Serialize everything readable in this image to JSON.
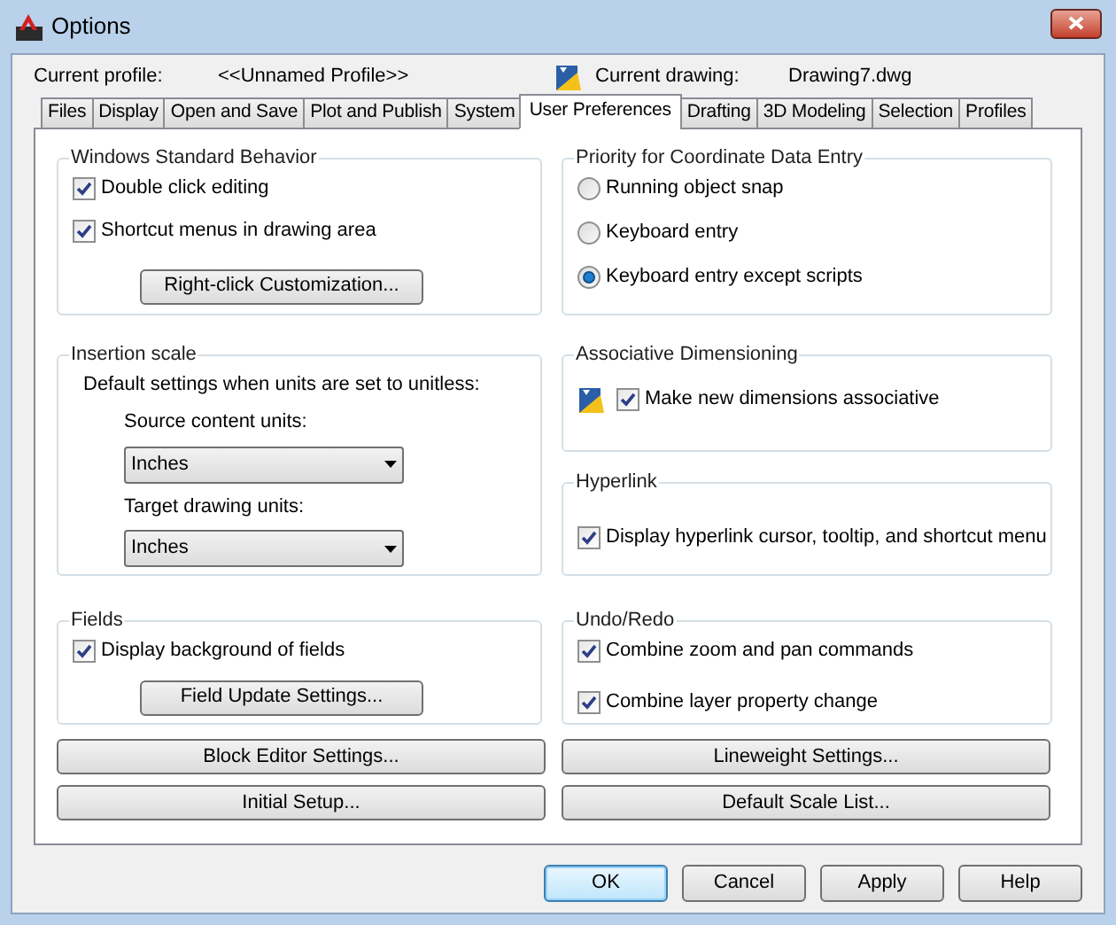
{
  "window": {
    "title": "Options"
  },
  "profile": {
    "label": "Current profile:",
    "value": "<<Unnamed Profile>>"
  },
  "drawing": {
    "label": "Current drawing:",
    "value": "Drawing7.dwg"
  },
  "tabs": [
    {
      "label": "Files",
      "selected": false
    },
    {
      "label": "Display",
      "selected": false
    },
    {
      "label": "Open and Save",
      "selected": false
    },
    {
      "label": "Plot and Publish",
      "selected": false
    },
    {
      "label": "System",
      "selected": false
    },
    {
      "label": "User Preferences",
      "selected": true
    },
    {
      "label": "Drafting",
      "selected": false
    },
    {
      "label": "3D Modeling",
      "selected": false
    },
    {
      "label": "Selection",
      "selected": false
    },
    {
      "label": "Profiles",
      "selected": false
    }
  ],
  "left_groups": [
    {
      "title": "Windows Standard Behavior",
      "items": [
        {
          "kind": "checkbox",
          "label": "Double click editing",
          "checked": true
        },
        {
          "kind": "checkbox",
          "label": "Shortcut menus in drawing area",
          "checked": true
        },
        {
          "kind": "button",
          "label": "Right-click Customization..."
        }
      ]
    },
    {
      "title": "Insertion scale",
      "items": [
        {
          "kind": "text",
          "label": "Default settings when units are set to unitless:"
        },
        {
          "kind": "label",
          "label": "Source content units:"
        },
        {
          "kind": "dropdown",
          "value": "Inches"
        },
        {
          "kind": "label",
          "label": "Target drawing units:"
        },
        {
          "kind": "dropdown",
          "value": "Inches"
        }
      ]
    },
    {
      "title": "Fields",
      "items": [
        {
          "kind": "checkbox",
          "label": "Display background of fields",
          "checked": true
        },
        {
          "kind": "button",
          "label": "Field Update Settings..."
        }
      ]
    }
  ],
  "right_groups": [
    {
      "title": "Priority for Coordinate Data Entry",
      "items": [
        {
          "kind": "radio",
          "label": "Running object snap",
          "selected": false
        },
        {
          "kind": "radio",
          "label": "Keyboard entry",
          "selected": false
        },
        {
          "kind": "radio",
          "label": "Keyboard entry except scripts",
          "selected": true
        }
      ]
    },
    {
      "title": "Associative Dimensioning",
      "items": [
        {
          "kind": "icon_checkbox",
          "label": "Make new dimensions associative",
          "checked": true
        }
      ]
    },
    {
      "title": "Hyperlink",
      "items": [
        {
          "kind": "checkbox",
          "label": "Display hyperlink cursor, tooltip, and shortcut menu",
          "checked": true
        }
      ]
    },
    {
      "title": "Undo/Redo",
      "items": [
        {
          "kind": "checkbox",
          "label": "Combine zoom and pan commands",
          "checked": true
        },
        {
          "kind": "checkbox",
          "label": "Combine layer property change",
          "checked": true
        }
      ]
    }
  ],
  "panel_buttons": [
    [
      "Block Editor Settings...",
      "Lineweight Settings..."
    ],
    [
      "Initial Setup...",
      "Default Scale List..."
    ]
  ],
  "dialog_buttons": [
    {
      "label": "OK",
      "default": true
    },
    {
      "label": "Cancel",
      "default": false
    },
    {
      "label": "Apply",
      "default": false
    },
    {
      "label": "Help",
      "default": false
    }
  ]
}
